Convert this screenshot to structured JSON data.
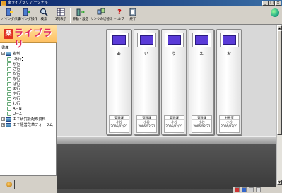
{
  "window": {
    "title": "楽ライブラリ パーソナル"
  },
  "toolbar": {
    "buttons": [
      {
        "label": "バインダ作成",
        "icon": "binder-create-icon"
      },
      {
        "label": "バインダ操作",
        "icon": "binder-operate-icon"
      },
      {
        "label": "検索",
        "icon": "search-icon"
      },
      {
        "label": "1列表示",
        "icon": "list-view-icon"
      },
      {
        "label": "移動・設定",
        "icon": "move-settings-icon"
      },
      {
        "label": "リンクの切替え",
        "icon": "link-switch-icon"
      },
      {
        "label": "ヘルプ",
        "icon": "help-icon"
      },
      {
        "label": "終了",
        "icon": "exit-icon"
      }
    ]
  },
  "logo": {
    "mark": "楽",
    "text": "ライブラリ"
  },
  "tree": {
    "header": "書庫",
    "root": "名刺",
    "items": [
      "あ行",
      "か行",
      "さ行",
      "た行",
      "な行",
      "は行",
      "ま行",
      "や行",
      "ら行",
      "わ行",
      "A－N",
      "O－Z"
    ],
    "selected": "あ行",
    "other_roots": [
      "ＩＴ研究会配布資料",
      "ＩＴ経営改革フォーラム"
    ]
  },
  "binders": [
    {
      "kana": "あ",
      "label": [
        "管理課",
        "小谷",
        "2006/02/21"
      ]
    },
    {
      "kana": "い",
      "label": [
        "管理課",
        "小谷",
        "2006/02/21"
      ]
    },
    {
      "kana": "う",
      "label": [
        "管理課",
        "小谷",
        "2006/02/21"
      ]
    },
    {
      "kana": "え",
      "label": [
        "管理課",
        "小谷",
        "2006/02/21"
      ]
    },
    {
      "kana": "お",
      "label": [
        "社長室",
        "小谷",
        "2006/02/21"
      ]
    }
  ],
  "colors": {
    "binder_tab": "#5a3bd8",
    "title_bar": "#0a246a",
    "logo_text": "#e02a60"
  }
}
